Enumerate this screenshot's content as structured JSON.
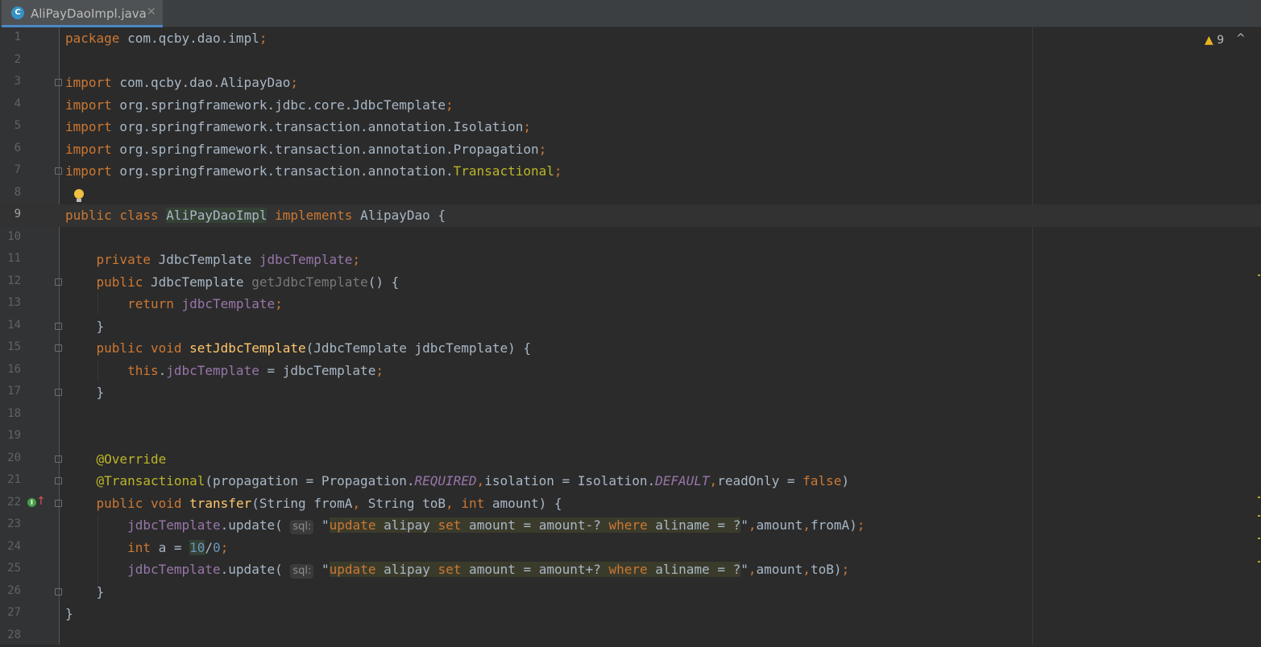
{
  "tab": {
    "icon_letter": "C",
    "title": "AliPayDaoImpl.java",
    "close_glyph": "✕"
  },
  "inspections": {
    "warning_glyph": "▲",
    "warning_count": "9",
    "nav_glyph": "^"
  },
  "colors": {
    "keyword": "#cc7832",
    "method": "#ffc66d",
    "field": "#9876aa",
    "annotation": "#bbb529",
    "number": "#6897bb",
    "text": "#a9b7c6"
  },
  "icons": {
    "gutter_bulb": "lightbulb-icon",
    "gutter_override": "overridden-method-icon",
    "tab_class": "java-class-icon"
  },
  "gutter": {
    "current_line": "9"
  },
  "lines": [
    {
      "no": "1",
      "parts": [
        {
          "text": "package",
          "cls": "kw"
        },
        {
          "text": " com.qcby.dao.impl"
        },
        {
          "text": ";",
          "cls": "kw"
        }
      ]
    },
    {
      "no": "2",
      "parts": []
    },
    {
      "no": "3",
      "parts": [
        {
          "text": "import",
          "cls": "kw"
        },
        {
          "text": " com.qcby.dao.AlipayDao"
        },
        {
          "text": ";",
          "cls": "kw"
        }
      ]
    },
    {
      "no": "4",
      "parts": [
        {
          "text": "import",
          "cls": "kw"
        },
        {
          "text": " org.springframework.jdbc.core.JdbcTemplate"
        },
        {
          "text": ";",
          "cls": "kw"
        }
      ]
    },
    {
      "no": "5",
      "parts": [
        {
          "text": "import",
          "cls": "kw"
        },
        {
          "text": " org.springframework.transaction.annotation.Isolation"
        },
        {
          "text": ";",
          "cls": "kw"
        }
      ]
    },
    {
      "no": "6",
      "parts": [
        {
          "text": "import",
          "cls": "kw"
        },
        {
          "text": " org.springframework.transaction.annotation.Propagation"
        },
        {
          "text": ";",
          "cls": "kw"
        }
      ]
    },
    {
      "no": "7",
      "parts": [
        {
          "text": "import",
          "cls": "kw"
        },
        {
          "text": " org.springframework.transaction.annotation."
        },
        {
          "text": "Transactional",
          "cls": "ann"
        },
        {
          "text": ";",
          "cls": "kw"
        }
      ]
    },
    {
      "no": "8",
      "parts": []
    },
    {
      "no": "9",
      "parts": [
        {
          "text": "public class",
          "cls": "kw"
        },
        {
          "text": " "
        },
        {
          "text": "AliPayDaoImpl",
          "cls": "hl"
        },
        {
          "text": " "
        },
        {
          "text": "implements",
          "cls": "kw"
        },
        {
          "text": " AlipayDao {"
        }
      ]
    },
    {
      "no": "10",
      "parts": []
    },
    {
      "no": "11",
      "parts": [
        {
          "text": "    "
        },
        {
          "text": "private",
          "cls": "kw"
        },
        {
          "text": " JdbcTemplate "
        },
        {
          "text": "jdbcTemplate",
          "cls": "fld"
        },
        {
          "text": ";",
          "cls": "kw"
        }
      ]
    },
    {
      "no": "12",
      "parts": [
        {
          "text": "    "
        },
        {
          "text": "public",
          "cls": "kw"
        },
        {
          "text": " JdbcTemplate "
        },
        {
          "text": "getJdbcTemplate",
          "cls": "grey"
        },
        {
          "text": "() {"
        }
      ]
    },
    {
      "no": "13",
      "parts": [
        {
          "text": "        "
        },
        {
          "text": "return",
          "cls": "kw"
        },
        {
          "text": " "
        },
        {
          "text": "jdbcTemplate",
          "cls": "fld"
        },
        {
          "text": ";",
          "cls": "kw"
        }
      ]
    },
    {
      "no": "14",
      "parts": [
        {
          "text": "    }"
        }
      ]
    },
    {
      "no": "15",
      "parts": [
        {
          "text": "    "
        },
        {
          "text": "public void",
          "cls": "kw"
        },
        {
          "text": " "
        },
        {
          "text": "setJdbcTemplate",
          "cls": "fn"
        },
        {
          "text": "(JdbcTemplate jdbcTemplate) {"
        }
      ]
    },
    {
      "no": "16",
      "parts": [
        {
          "text": "        "
        },
        {
          "text": "this",
          "cls": "kw"
        },
        {
          "text": "."
        },
        {
          "text": "jdbcTemplate",
          "cls": "fld"
        },
        {
          "text": " = jdbcTemplate"
        },
        {
          "text": ";",
          "cls": "kw"
        }
      ]
    },
    {
      "no": "17",
      "parts": [
        {
          "text": "    }"
        }
      ]
    },
    {
      "no": "18",
      "parts": []
    },
    {
      "no": "19",
      "parts": []
    },
    {
      "no": "20",
      "parts": [
        {
          "text": "    "
        },
        {
          "text": "@Override",
          "cls": "ann"
        }
      ]
    },
    {
      "no": "21",
      "parts": [
        {
          "text": "    "
        },
        {
          "text": "@Transactional",
          "cls": "ann"
        },
        {
          "text": "(propagation = Propagation."
        },
        {
          "text": "REQUIRED",
          "cls": "cst"
        },
        {
          "text": ",",
          "cls": "kw"
        },
        {
          "text": "isolation = Isolation."
        },
        {
          "text": "DEFAULT",
          "cls": "cst"
        },
        {
          "text": ",",
          "cls": "kw"
        },
        {
          "text": "readOnly = "
        },
        {
          "text": "false",
          "cls": "kw"
        },
        {
          "text": ")"
        }
      ]
    },
    {
      "no": "22",
      "parts": [
        {
          "text": "    "
        },
        {
          "text": "public void",
          "cls": "kw"
        },
        {
          "text": " "
        },
        {
          "text": "transfer",
          "cls": "fn"
        },
        {
          "text": "(String fromA"
        },
        {
          "text": ",",
          "cls": "kw"
        },
        {
          "text": " String toB"
        },
        {
          "text": ",",
          "cls": "kw"
        },
        {
          "text": " "
        },
        {
          "text": "int",
          "cls": "kw"
        },
        {
          "text": " amount) {"
        }
      ]
    },
    {
      "no": "23",
      "parts": [
        {
          "text": "        "
        },
        {
          "text": "jdbcTemplate",
          "cls": "fld"
        },
        {
          "text": ".update( "
        },
        {
          "text": "sql:",
          "cls": "hint"
        },
        {
          "text": " \""
        },
        {
          "text": "update",
          "cls": "kw inj"
        },
        {
          "text": " alipay ",
          "cls": "inj"
        },
        {
          "text": "set",
          "cls": "kw inj"
        },
        {
          "text": " amount = amount-? ",
          "cls": "inj"
        },
        {
          "text": "where",
          "cls": "kw inj"
        },
        {
          "text": " aliname = ?",
          "cls": "inj"
        },
        {
          "text": "\""
        },
        {
          "text": ",",
          "cls": "kw"
        },
        {
          "text": "amount"
        },
        {
          "text": ",",
          "cls": "kw"
        },
        {
          "text": "fromA)"
        },
        {
          "text": ";",
          "cls": "kw"
        }
      ]
    },
    {
      "no": "24",
      "parts": [
        {
          "text": "        "
        },
        {
          "text": "int",
          "cls": "kw"
        },
        {
          "text": " a = "
        },
        {
          "text": "10",
          "cls": "num hl"
        },
        {
          "text": "/"
        },
        {
          "text": "0",
          "cls": "num"
        },
        {
          "text": ";",
          "cls": "kw"
        }
      ]
    },
    {
      "no": "25",
      "parts": [
        {
          "text": "        "
        },
        {
          "text": "jdbcTemplate",
          "cls": "fld"
        },
        {
          "text": ".update( "
        },
        {
          "text": "sql:",
          "cls": "hint"
        },
        {
          "text": " \""
        },
        {
          "text": "update",
          "cls": "kw inj"
        },
        {
          "text": " alipay ",
          "cls": "inj"
        },
        {
          "text": "set",
          "cls": "kw inj"
        },
        {
          "text": " amount = amount+? ",
          "cls": "inj"
        },
        {
          "text": "where",
          "cls": "kw inj"
        },
        {
          "text": " aliname = ?",
          "cls": "inj"
        },
        {
          "text": "\""
        },
        {
          "text": ",",
          "cls": "kw"
        },
        {
          "text": "amount"
        },
        {
          "text": ",",
          "cls": "kw"
        },
        {
          "text": "toB)"
        },
        {
          "text": ";",
          "cls": "kw"
        }
      ]
    },
    {
      "no": "26",
      "parts": [
        {
          "text": "    }"
        }
      ]
    },
    {
      "no": "27",
      "parts": [
        {
          "text": "}"
        }
      ]
    },
    {
      "no": "28",
      "parts": []
    }
  ]
}
